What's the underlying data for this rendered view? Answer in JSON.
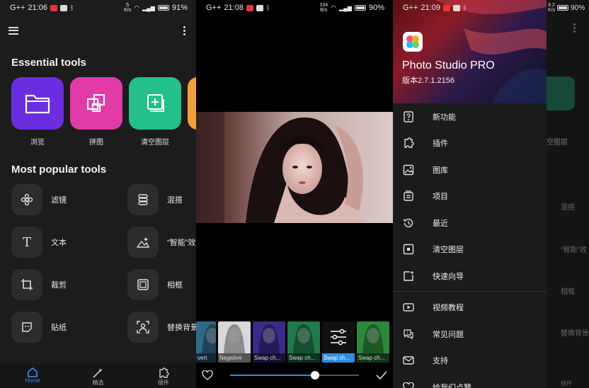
{
  "screen1": {
    "status": {
      "carrier": "G++",
      "time": "21:06",
      "net_num": "5",
      "net_unit": "K/s",
      "battery": "91%"
    },
    "essential_title": "Essential tools",
    "essential_tools": [
      {
        "label": "浏览",
        "color": "#6a2ee0",
        "icon": "folder-icon"
      },
      {
        "label": "拼图",
        "color": "#e23aa6",
        "icon": "collage-icon"
      },
      {
        "label": "清空图层",
        "color": "#22c08a",
        "icon": "add-layer-icon"
      },
      {
        "label": "",
        "color": "#f0a23a",
        "icon": "partial-tile"
      }
    ],
    "popular_title": "Most popular tools",
    "popular_tools": [
      {
        "label": "滤镜",
        "icon": "flower-filter-icon"
      },
      {
        "label": "混搭",
        "icon": "stack-icon"
      },
      {
        "label": "文本",
        "icon": "text-icon"
      },
      {
        "label": "“智能”效",
        "icon": "sparkle-effect-icon"
      },
      {
        "label": "裁剪",
        "icon": "crop-icon"
      },
      {
        "label": "相框",
        "icon": "frame-icon"
      },
      {
        "label": "贴纸",
        "icon": "sticker-icon"
      },
      {
        "label": "替换背景",
        "icon": "replace-background-icon"
      }
    ],
    "nav": [
      {
        "label": "Home",
        "icon": "home-icon",
        "active": true
      },
      {
        "label": "精选",
        "icon": "magic-wand-icon",
        "active": false
      },
      {
        "label": "插件",
        "icon": "plugin-icon",
        "active": false
      }
    ]
  },
  "screen2": {
    "status": {
      "carrier": "G++",
      "time": "21:08",
      "net_num": "104",
      "net_unit": "B/s",
      "battery": "90%"
    },
    "filters": [
      {
        "label": "vert",
        "tone": "#2d6a8a"
      },
      {
        "label": "Negative",
        "tone": "#d8d8d8"
      },
      {
        "label": "Swap ch...",
        "tone": "#3b2a8a"
      },
      {
        "label": "Swap ch...",
        "tone": "#1f7a4a"
      },
      {
        "label": "Swap ch...",
        "tone": "#111111",
        "selected": true
      },
      {
        "label": "Swap ch...",
        "tone": "#2a8a3a"
      }
    ],
    "slider": {
      "value": 0.66
    }
  },
  "screen3": {
    "status": {
      "carrier": "G++",
      "time": "21:09",
      "net_num": "8.2",
      "net_unit": "K/s",
      "battery": "90%"
    },
    "app_name": "Photo Studio PRO",
    "app_version": "版本2.7.1.2156",
    "menu_group1": [
      {
        "label": "新功能",
        "icon": "whats-new-icon"
      },
      {
        "label": "插件",
        "icon": "plugin-icon"
      },
      {
        "label": "图库",
        "icon": "gallery-icon"
      },
      {
        "label": "项目",
        "icon": "projects-icon"
      },
      {
        "label": "最近",
        "icon": "recent-icon"
      },
      {
        "label": "清空图层",
        "icon": "empty-layer-icon"
      },
      {
        "label": "快速向导",
        "icon": "quick-guide-icon"
      }
    ],
    "menu_group2": [
      {
        "label": "视频教程",
        "icon": "video-tutorial-icon"
      },
      {
        "label": "常见问题",
        "icon": "faq-icon"
      },
      {
        "label": "支持",
        "icon": "mail-icon"
      },
      {
        "label": "给我们点赞",
        "icon": "heart-icon"
      }
    ],
    "behind_labels": [
      "空图层",
      "混搭",
      "“智能”效",
      "相框",
      "替换背景",
      "插件"
    ]
  }
}
